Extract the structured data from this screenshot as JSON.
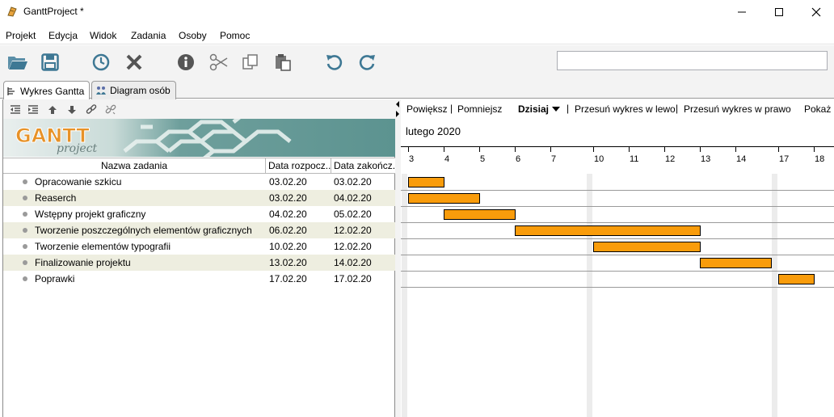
{
  "window": {
    "title": "GanttProject *"
  },
  "menu": [
    "Projekt",
    "Edycja",
    "Widok",
    "Zadania",
    "Osoby",
    "Pomoc"
  ],
  "toolbar": {
    "icons": [
      "open-folder-icon",
      "save-icon",
      "history-icon",
      "delete-icon",
      "info-icon",
      "cut-icon",
      "copy-icon",
      "paste-icon",
      "undo-icon",
      "redo-icon"
    ],
    "search_value": ""
  },
  "tabs": [
    {
      "label": "Wykres Gantta"
    },
    {
      "label": "Diagram osób"
    }
  ],
  "banner": {
    "logo_text": "GANTT project"
  },
  "table": {
    "headers": {
      "name": "Nazwa zadania",
      "start": "Data rozpocz...",
      "end": "Data zakończ..."
    },
    "rows": [
      {
        "name": "Opracowanie szkicu",
        "start": "03.02.20",
        "end": "03.02.20"
      },
      {
        "name": "Reaserch",
        "start": "03.02.20",
        "end": "04.02.20"
      },
      {
        "name": "Wstępny projekt graficzny",
        "start": "04.02.20",
        "end": "05.02.20"
      },
      {
        "name": "Tworzenie poszczególnych elementów graficznych",
        "start": "06.02.20",
        "end": "12.02.20"
      },
      {
        "name": "Tworzenie elementów typografii",
        "start": "10.02.20",
        "end": "12.02.20"
      },
      {
        "name": "Finalizowanie projektu",
        "start": "13.02.20",
        "end": "14.02.20"
      },
      {
        "name": "Poprawki",
        "start": "17.02.20",
        "end": "17.02.20"
      }
    ]
  },
  "chart": {
    "nav": {
      "zoom_in": "Powiększ",
      "zoom_out": "Pomniejsz",
      "today": "Dzisiaj",
      "scroll_left": "Przesuń wykres w lewo",
      "scroll_right": "Przesuń wykres w prawo",
      "show": "Pokaż"
    },
    "month": "lutego 2020",
    "days": [
      "3",
      "4",
      "5",
      "6",
      "7",
      "10",
      "11",
      "12",
      "13",
      "14",
      "17",
      "18"
    ],
    "bar_color": "#f99c0b"
  }
}
